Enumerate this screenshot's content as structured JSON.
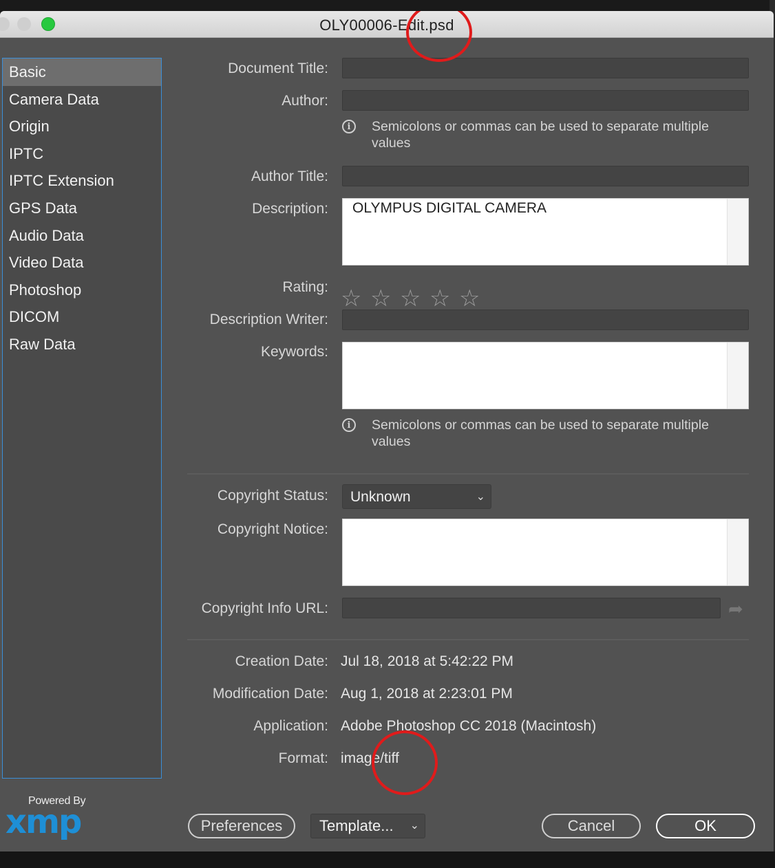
{
  "window": {
    "title": "OLY00006-Edit.psd"
  },
  "sidebar": {
    "items": [
      {
        "label": "Basic"
      },
      {
        "label": "Camera Data"
      },
      {
        "label": "Origin"
      },
      {
        "label": "IPTC"
      },
      {
        "label": "IPTC Extension"
      },
      {
        "label": "GPS Data"
      },
      {
        "label": "Audio Data"
      },
      {
        "label": "Video Data"
      },
      {
        "label": "Photoshop"
      },
      {
        "label": "DICOM"
      },
      {
        "label": "Raw Data"
      }
    ],
    "selected": "Basic"
  },
  "branding": {
    "powered_by": "Powered By",
    "logo": "xmp"
  },
  "form": {
    "document_title_label": "Document Title:",
    "document_title_value": "",
    "author_label": "Author:",
    "author_value": "",
    "author_hint": "Semicolons or commas can be used to separate multiple values",
    "author_title_label": "Author Title:",
    "author_title_value": "",
    "description_label": "Description:",
    "description_value": "OLYMPUS DIGITAL CAMERA",
    "rating_label": "Rating:",
    "rating_value": 0,
    "rating_max": 5,
    "description_writer_label": "Description Writer:",
    "description_writer_value": "",
    "keywords_label": "Keywords:",
    "keywords_value": "",
    "keywords_hint": "Semicolons or commas can be used to separate multiple values",
    "copyright_status_label": "Copyright Status:",
    "copyright_status_value": "Unknown",
    "copyright_notice_label": "Copyright Notice:",
    "copyright_notice_value": "",
    "copyright_url_label": "Copyright Info URL:",
    "copyright_url_value": ""
  },
  "info": {
    "creation_date_label": "Creation Date:",
    "creation_date": "Jul 18, 2018 at 5:42:22 PM",
    "modification_date_label": "Modification Date:",
    "modification_date": "Aug 1, 2018 at 2:23:01 PM",
    "application_label": "Application:",
    "application": "Adobe Photoshop CC 2018 (Macintosh)",
    "format_label": "Format:",
    "format": "image/tiff"
  },
  "buttons": {
    "preferences": "Preferences",
    "template": "Template...",
    "cancel": "Cancel",
    "ok": "OK"
  },
  "colors": {
    "dialog_bg": "#525252",
    "sidebar_selected": "#6e6e6e",
    "sidebar_border": "#3a8fd9",
    "annotation_circle": "#e01b1b",
    "xmp_logo": "#1e8fd6"
  }
}
